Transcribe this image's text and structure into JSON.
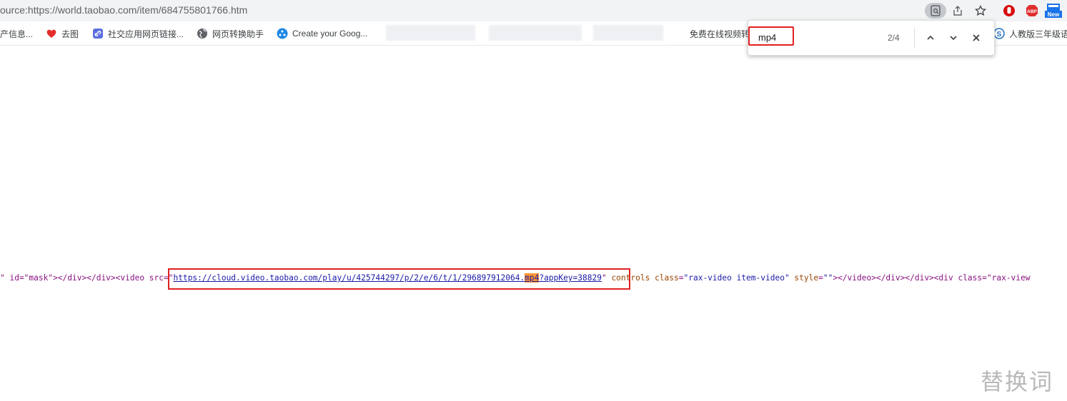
{
  "address_bar": {
    "url": "ource:https://world.taobao.com/item/684755801766.htm"
  },
  "toolbar_icons": {
    "find_in_page": "find-in-page-icon",
    "share": "share-icon",
    "bookmark": "star-icon",
    "ext_red": "red-hand-extension-icon",
    "ext_abp": "ABP",
    "ext_new": "New"
  },
  "bookmarks": [
    {
      "label": "产信息...",
      "icon": "folder-icon"
    },
    {
      "label": "去图",
      "icon": "red-heart-icon"
    },
    {
      "label": "社交应用网页链接...",
      "icon": "link-icon"
    },
    {
      "label": "网页转换助手",
      "icon": "globe-icon"
    },
    {
      "label": "Create your Goog...",
      "icon": "blue-dots-icon"
    },
    {
      "label": "免费在线视频转",
      "icon": "blue-moon-icon"
    },
    {
      "label": "人教版三年级语",
      "icon": "s-logo-icon"
    }
  ],
  "find_bar": {
    "query": "mp4",
    "count": "2/4"
  },
  "source": {
    "pre": "\" id=\"mask\"></div></div><video src=\"",
    "url_before": "https://cloud.video.taobao.com/play/u/425744297/p/2/e/6/t/1/296897912064.",
    "url_match": "mp4",
    "url_after": "?appKey=38829",
    "quote_close": "\"",
    "attr_controls": " controls ",
    "attr_class": "class",
    "eq1": "=",
    "class_value": "\"rax-video item-video\"",
    "attr_style": " style",
    "eq2": "=",
    "style_value": "\"\"",
    "tail": "></video></div></div><div class=\"rax-view"
  },
  "watermark": "替换词",
  "colors": {
    "highlight_box": "#e02020",
    "match_highlight": "#ff9632"
  }
}
